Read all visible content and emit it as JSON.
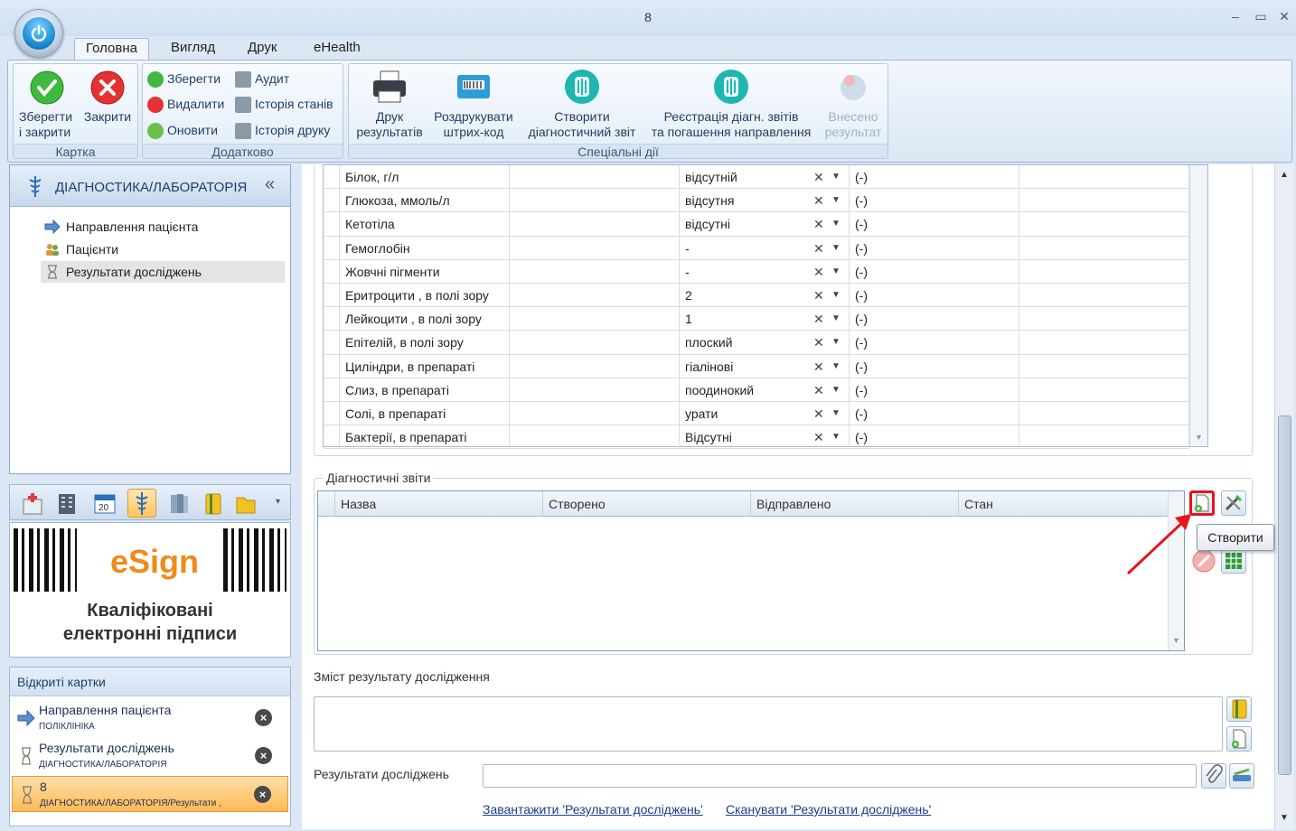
{
  "window": {
    "title": "8",
    "minimize": "‒",
    "maximize": "▭",
    "close": "✕"
  },
  "ribbon": {
    "tabs": [
      "Головна",
      "Вигляд",
      "Друк",
      "eHealth"
    ],
    "groups": {
      "card": {
        "label": "Картка",
        "save_close": "Зберегти\nі закрити",
        "close": "Закрити"
      },
      "extra": {
        "label": "Додатково",
        "save": "Зберегти",
        "delete": "Видалити",
        "refresh": "Оновити",
        "audit": "Аудит",
        "state_history": "Історія станів",
        "print_history": "Історія друку"
      },
      "special": {
        "label": "Спеціальні дії",
        "print_results": "Друк\nрезультатів",
        "print_barcode": "Роздрукувати\nштрих-код",
        "create_report": "Створити\nдіагностичний звіт",
        "register_reports": "Реєстрація діагн. звітів\nта погашення направлення",
        "entered_result": "Внесено\nрезультат"
      }
    }
  },
  "nav": {
    "header": "ДІАГНОСТИКА/ЛАБОРАТОРІЯ",
    "collapse": "«",
    "items": [
      "Направлення пацієнта",
      "Пацієнти",
      "Результати досліджень"
    ]
  },
  "esign": {
    "brand": "eSign",
    "tagline": "Кваліфіковані\nелектронні підписи"
  },
  "open_cards": {
    "header": "Відкриті картки",
    "cards": [
      {
        "title": "Направлення пацієнта",
        "subtitle": "ПОЛІКЛІНІКА"
      },
      {
        "title": "Результати досліджень",
        "subtitle": "ДІАГНОСТИКА/ЛАБОРАТОРІЯ"
      },
      {
        "title": "8",
        "subtitle": "ДІАГНОСТИКА/ЛАБОРАТОРІЯ/Результати ,"
      }
    ]
  },
  "results_grid": {
    "rows": [
      {
        "name": "Білок, г/л",
        "value": "відсутній",
        "norm": "(-)"
      },
      {
        "name": "Глюкоза, ммоль/л",
        "value": "відсутня",
        "norm": "(-)"
      },
      {
        "name": "Кетотіла",
        "value": "відсутні",
        "norm": "(-)"
      },
      {
        "name": "Гемоглобін",
        "value": "-",
        "norm": "(-)"
      },
      {
        "name": "Жовчні пігменти",
        "value": "-",
        "norm": "(-)"
      },
      {
        "name": "Еритроцити  , в полі зору",
        "value": "2",
        "norm": "(-)"
      },
      {
        "name": "Лейкоцити  , в полі зору",
        "value": "1",
        "norm": "(-)"
      },
      {
        "name": "Епітелій, в полі зору",
        "value": "плоский",
        "norm": "(-)"
      },
      {
        "name": "Циліндри, в препараті",
        "value": "гіалінові",
        "norm": "(-)"
      },
      {
        "name": "Слиз, в препараті",
        "value": "поодинокий",
        "norm": "(-)"
      },
      {
        "name": "Солі, в препараті",
        "value": "урати",
        "norm": "(-)"
      },
      {
        "name": "Бактерії, в препараті",
        "value": "Відсутні",
        "norm": "(-)"
      }
    ]
  },
  "reports": {
    "title": "Діагностичні звіти",
    "columns": [
      "Назва",
      "Створено",
      "Відправлено",
      "Стан"
    ],
    "tooltip": "Створити"
  },
  "content": {
    "label": "Зміст результату дослідження",
    "value": ""
  },
  "results_file": {
    "label": "Результати досліджень",
    "value": "",
    "upload_link": "Завантажити 'Результати досліджень'",
    "scan_link": "Сканувати 'Результати досліджень'"
  },
  "colors": {
    "highlight": "#e8131b",
    "accent": "#1e8fd8",
    "active_card": "#ffb957"
  }
}
